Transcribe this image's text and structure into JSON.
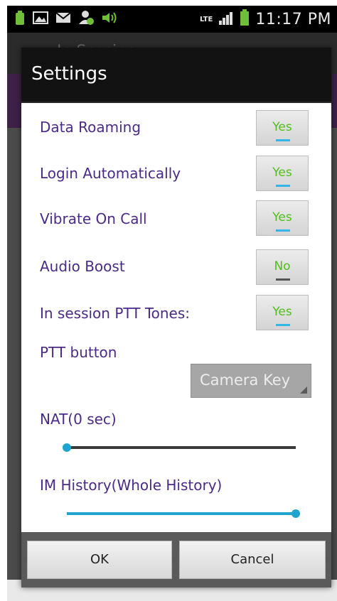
{
  "status_bar": {
    "time": "11:17 PM",
    "network": "LTE",
    "notification_icons": [
      "app-notification-icon",
      "image-icon",
      "mail-icon",
      "contact-icon",
      "volume-icon"
    ],
    "system_icons": [
      "signal-icon",
      "battery-icon"
    ]
  },
  "background": {
    "header_title": "In Session"
  },
  "dialog": {
    "title": "Settings",
    "settings": [
      {
        "label": "Data Roaming",
        "value": "Yes"
      },
      {
        "label": "Login Automatically",
        "value": "Yes"
      },
      {
        "label": "Vibrate On Call",
        "value": "Yes"
      },
      {
        "label": "Audio Boost",
        "value": "No"
      },
      {
        "label": "In session PTT Tones:",
        "value": "Yes"
      }
    ],
    "ptt_button": {
      "label": "PTT button",
      "selected": "Camera Key"
    },
    "nat": {
      "label": "NAT(0 sec)",
      "level": 0
    },
    "im_history": {
      "label": "IM History(Whole History)",
      "level": 1
    },
    "buttons": {
      "ok": "OK",
      "cancel": "Cancel"
    }
  },
  "colors": {
    "label": "#4a2a86",
    "toggle_on_text": "#4fbf1a",
    "accent": "#33b5e5"
  }
}
